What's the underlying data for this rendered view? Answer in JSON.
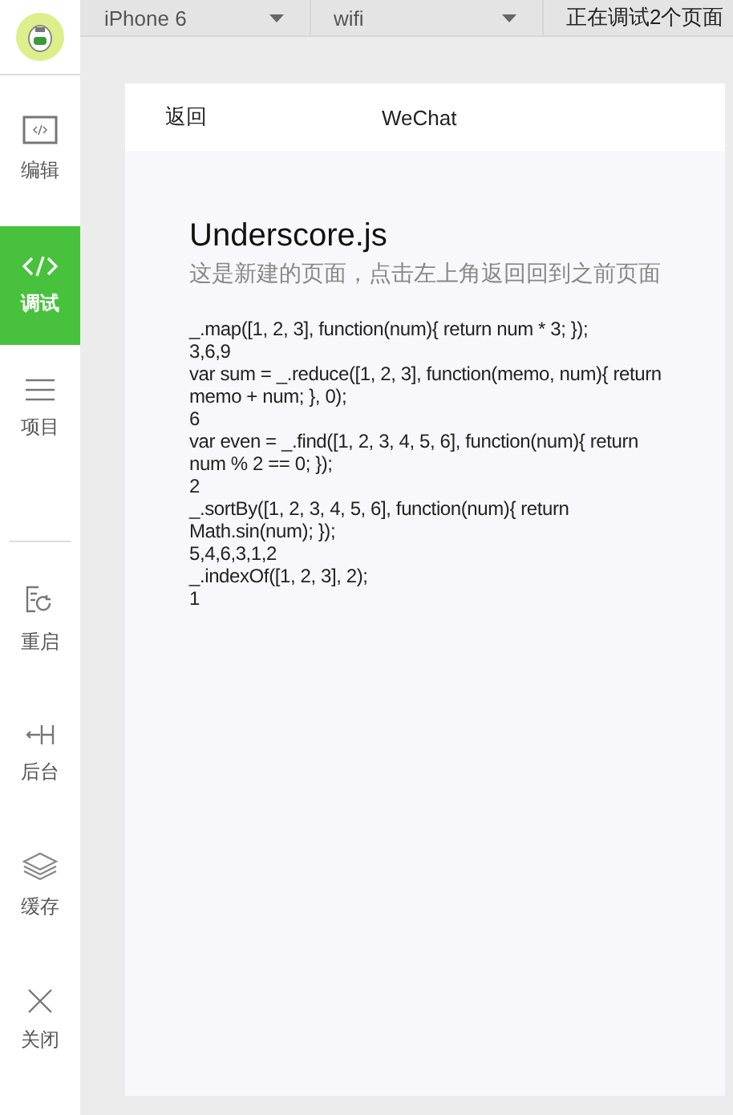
{
  "sidebar": {
    "items": [
      {
        "label": "编辑",
        "kind": "editor",
        "selected": false
      },
      {
        "label": "调试",
        "kind": "debug",
        "selected": true
      },
      {
        "label": "项目",
        "kind": "project",
        "selected": false
      },
      {
        "label": "重启",
        "kind": "restart",
        "selected": false
      },
      {
        "label": "后台",
        "kind": "background",
        "selected": false
      },
      {
        "label": "缓存",
        "kind": "cache",
        "selected": false
      },
      {
        "label": "关闭",
        "kind": "close",
        "selected": false
      }
    ]
  },
  "toolbar": {
    "dropdowns": [
      {
        "value": "iPhone 6"
      },
      {
        "value": "wifi"
      },
      {
        "value": "正在调试2个页面"
      }
    ]
  },
  "phone": {
    "nav": {
      "back": "返回",
      "title": "WeChat"
    },
    "heading": "Underscore.js",
    "subtitle": "这是新建的页面，点击左上角返回回到之前页面",
    "lines": [
      "_.map([1, 2, 3], function(num){ return num * 3; });",
      "3,6,9",
      "var sum = _.reduce([1, 2, 3], function(memo, num){ return memo + num; }, 0);",
      "6",
      "var even = _.find([1, 2, 3, 4, 5, 6], function(num){ return num % 2 == 0; });",
      "2",
      "_.sortBy([1, 2, 3, 4, 5, 6], function(num){ return Math.sin(num); });",
      "5,4,6,3,1,2",
      "_.indexOf([1, 2, 3], 2);",
      "1"
    ]
  }
}
